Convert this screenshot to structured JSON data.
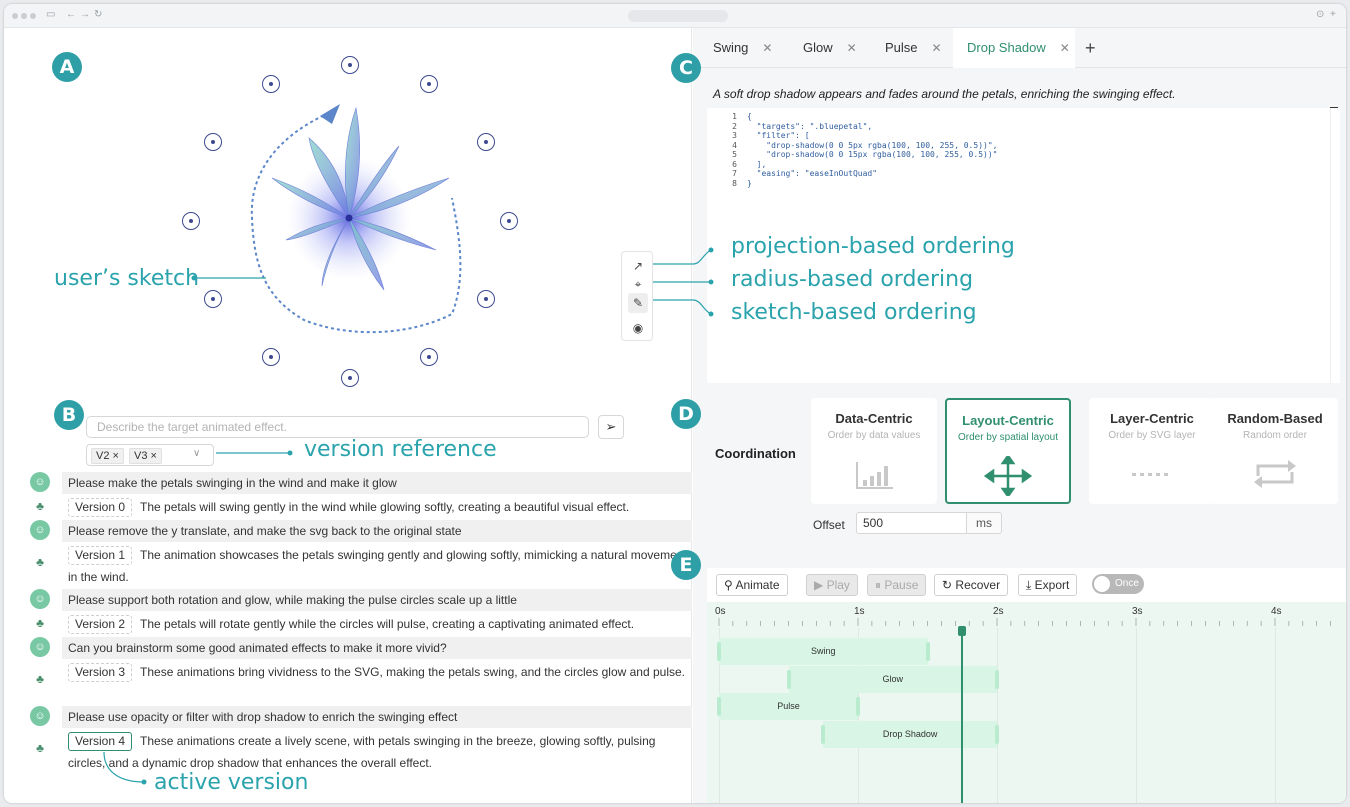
{
  "panels": {
    "a": "A",
    "b": "B",
    "c": "C",
    "d": "D",
    "e": "E"
  },
  "annotations": {
    "users_sketch": "user’s sketch",
    "projection": "projection-based ordering",
    "radius": "radius-based ordering",
    "sketch": "sketch-based ordering",
    "version_reference": "version reference",
    "active_version": "active version"
  },
  "colors": {
    "accent": "#2e8f6e",
    "annotation": "#2aa3ad",
    "target_ring": "#3d4a8f",
    "sketch": "#5b86c9"
  },
  "view_tools": [
    "arrow-up-right-icon",
    "crosshair-icon",
    "pen-sketch-icon",
    "eye-icon"
  ],
  "prompt": {
    "placeholder": "Describe the target animated effect.",
    "value": ""
  },
  "version_select": {
    "tags": [
      "V2",
      "V3"
    ]
  },
  "chat": [
    {
      "role": "user",
      "text": "Please make the petals swinging in the wind and make it glow"
    },
    {
      "role": "bot",
      "version": "Version 0",
      "text": "The petals will swing gently in the wind while glowing softly, creating a beautiful visual effect."
    },
    {
      "role": "user",
      "text": "Please remove the y translate, and make the svg back to the original state"
    },
    {
      "role": "bot",
      "version": "Version 1",
      "text": "The animation showcases the petals swinging gently and glowing softly, mimicking a natural movement in the wind."
    },
    {
      "role": "user",
      "text": "Please support both rotation and glow, while making the pulse circles scale up a little"
    },
    {
      "role": "bot",
      "version": "Version 2",
      "text": "The petals will rotate gently while the circles will pulse, creating a captivating animated effect."
    },
    {
      "role": "user",
      "text": "Can you brainstorm some good animated effects to make it more vivid?"
    },
    {
      "role": "bot",
      "version": "Version 3",
      "text": "These animations bring vividness to the SVG, making the petals swing, and the circles glow and pulse."
    },
    {
      "role": "user",
      "text": "Please use opacity or filter with drop shadow to enrich the swinging effect"
    },
    {
      "role": "bot",
      "version": "Version 4",
      "active": true,
      "text": "These animations create a lively scene, with petals swinging in the breeze, glowing softly, pulsing circles, and a dynamic drop shadow that enhances the overall effect."
    }
  ],
  "tabs": [
    {
      "label": "Swing"
    },
    {
      "label": "Glow"
    },
    {
      "label": "Pulse"
    },
    {
      "label": "Drop Shadow",
      "active": true
    }
  ],
  "tab_add": "+",
  "effect_description": "A soft drop shadow appears and fades around the petals, enriching the swinging effect.",
  "code": {
    "line_numbers": [
      "1",
      "2",
      "3",
      "4",
      "5",
      "6",
      "7",
      "8"
    ],
    "lines": [
      "{",
      "  \"targets\": \".bluepetal\",",
      "  \"filter\": [",
      "    \"drop-shadow(0 0 5px rgba(100, 100, 255, 0.5))\",",
      "    \"drop-shadow(0 0 15px rgba(100, 100, 255, 0.5))\"",
      "  ],",
      "  \"easing\": \"easeInOutQuad\"",
      "}"
    ]
  },
  "coordination": {
    "label": "Coordination",
    "options": [
      {
        "title": "Data-Centric",
        "subtitle": "Order by data values",
        "icon": "bar-chart-icon"
      },
      {
        "title": "Layout-Centric",
        "subtitle": "Order by spatial layout",
        "icon": "move-arrows-icon",
        "active": true
      },
      {
        "title": "Layer-Centric",
        "subtitle": "Order by SVG layer",
        "icon": "dots-icon"
      },
      {
        "title": "Random-Based",
        "subtitle": "Random order",
        "icon": "repeat-icon"
      }
    ],
    "offset_label": "Offset",
    "offset_value": "500",
    "offset_unit": "ms"
  },
  "timeline_controls": {
    "animate": "Animate",
    "play": "Play",
    "pause": "Pause",
    "recover": "Recover",
    "export": "Export",
    "mode": "Once"
  },
  "timeline": {
    "ticks": [
      "0s",
      "1s",
      "2s",
      "3s",
      "4s"
    ],
    "tracks": [
      {
        "name": "Swing",
        "start": 0.0,
        "end": 1.5
      },
      {
        "name": "Glow",
        "start": 0.5,
        "end": 2.0
      },
      {
        "name": "Pulse",
        "start": 0.0,
        "end": 1.0
      },
      {
        "name": "Drop Shadow",
        "start": 0.75,
        "end": 2.0
      }
    ],
    "playhead": 1.75
  }
}
